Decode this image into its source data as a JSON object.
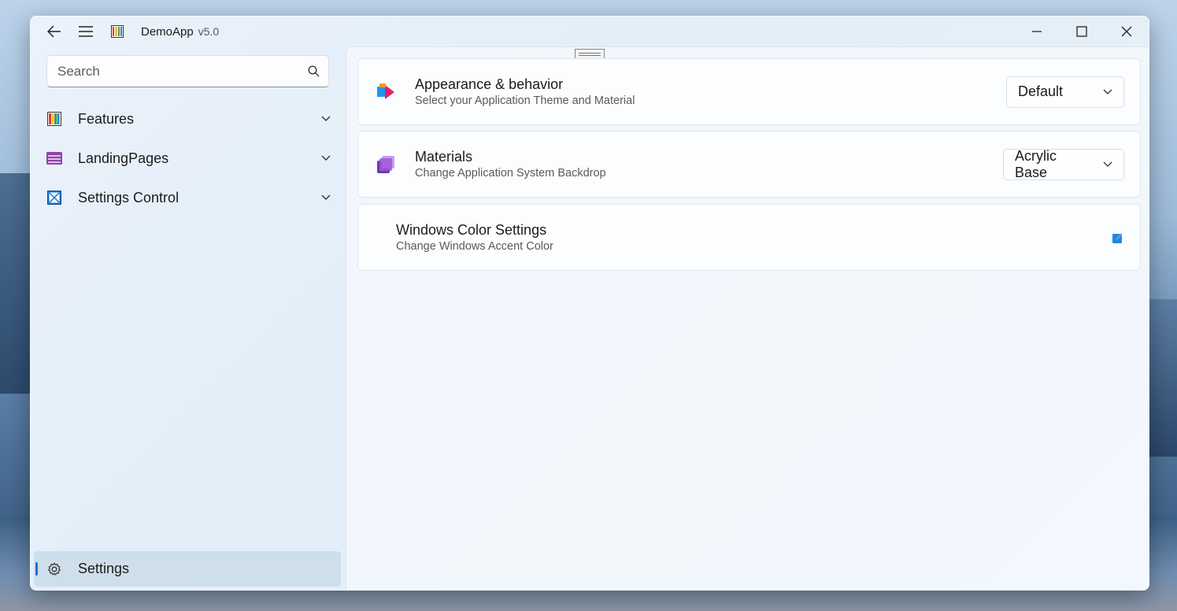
{
  "app": {
    "title": "DemoApp",
    "version": "v5.0"
  },
  "search": {
    "placeholder": "Search"
  },
  "nav": {
    "items": [
      {
        "label": "Features"
      },
      {
        "label": "LandingPages"
      },
      {
        "label": "Settings Control"
      }
    ],
    "footer": {
      "label": "Settings",
      "selected": true
    }
  },
  "settings": {
    "appearance": {
      "title": "Appearance & behavior",
      "subtitle": "Select your Application Theme and Material",
      "value": "Default"
    },
    "materials": {
      "title": "Materials",
      "subtitle": "Change Application System Backdrop",
      "value": "Acrylic Base"
    },
    "windows_color": {
      "title": "Windows Color Settings",
      "subtitle": "Change Windows Accent Color"
    }
  },
  "colors": {
    "accent": "#1a73d0",
    "selected_bg": "#c9dbe6"
  }
}
